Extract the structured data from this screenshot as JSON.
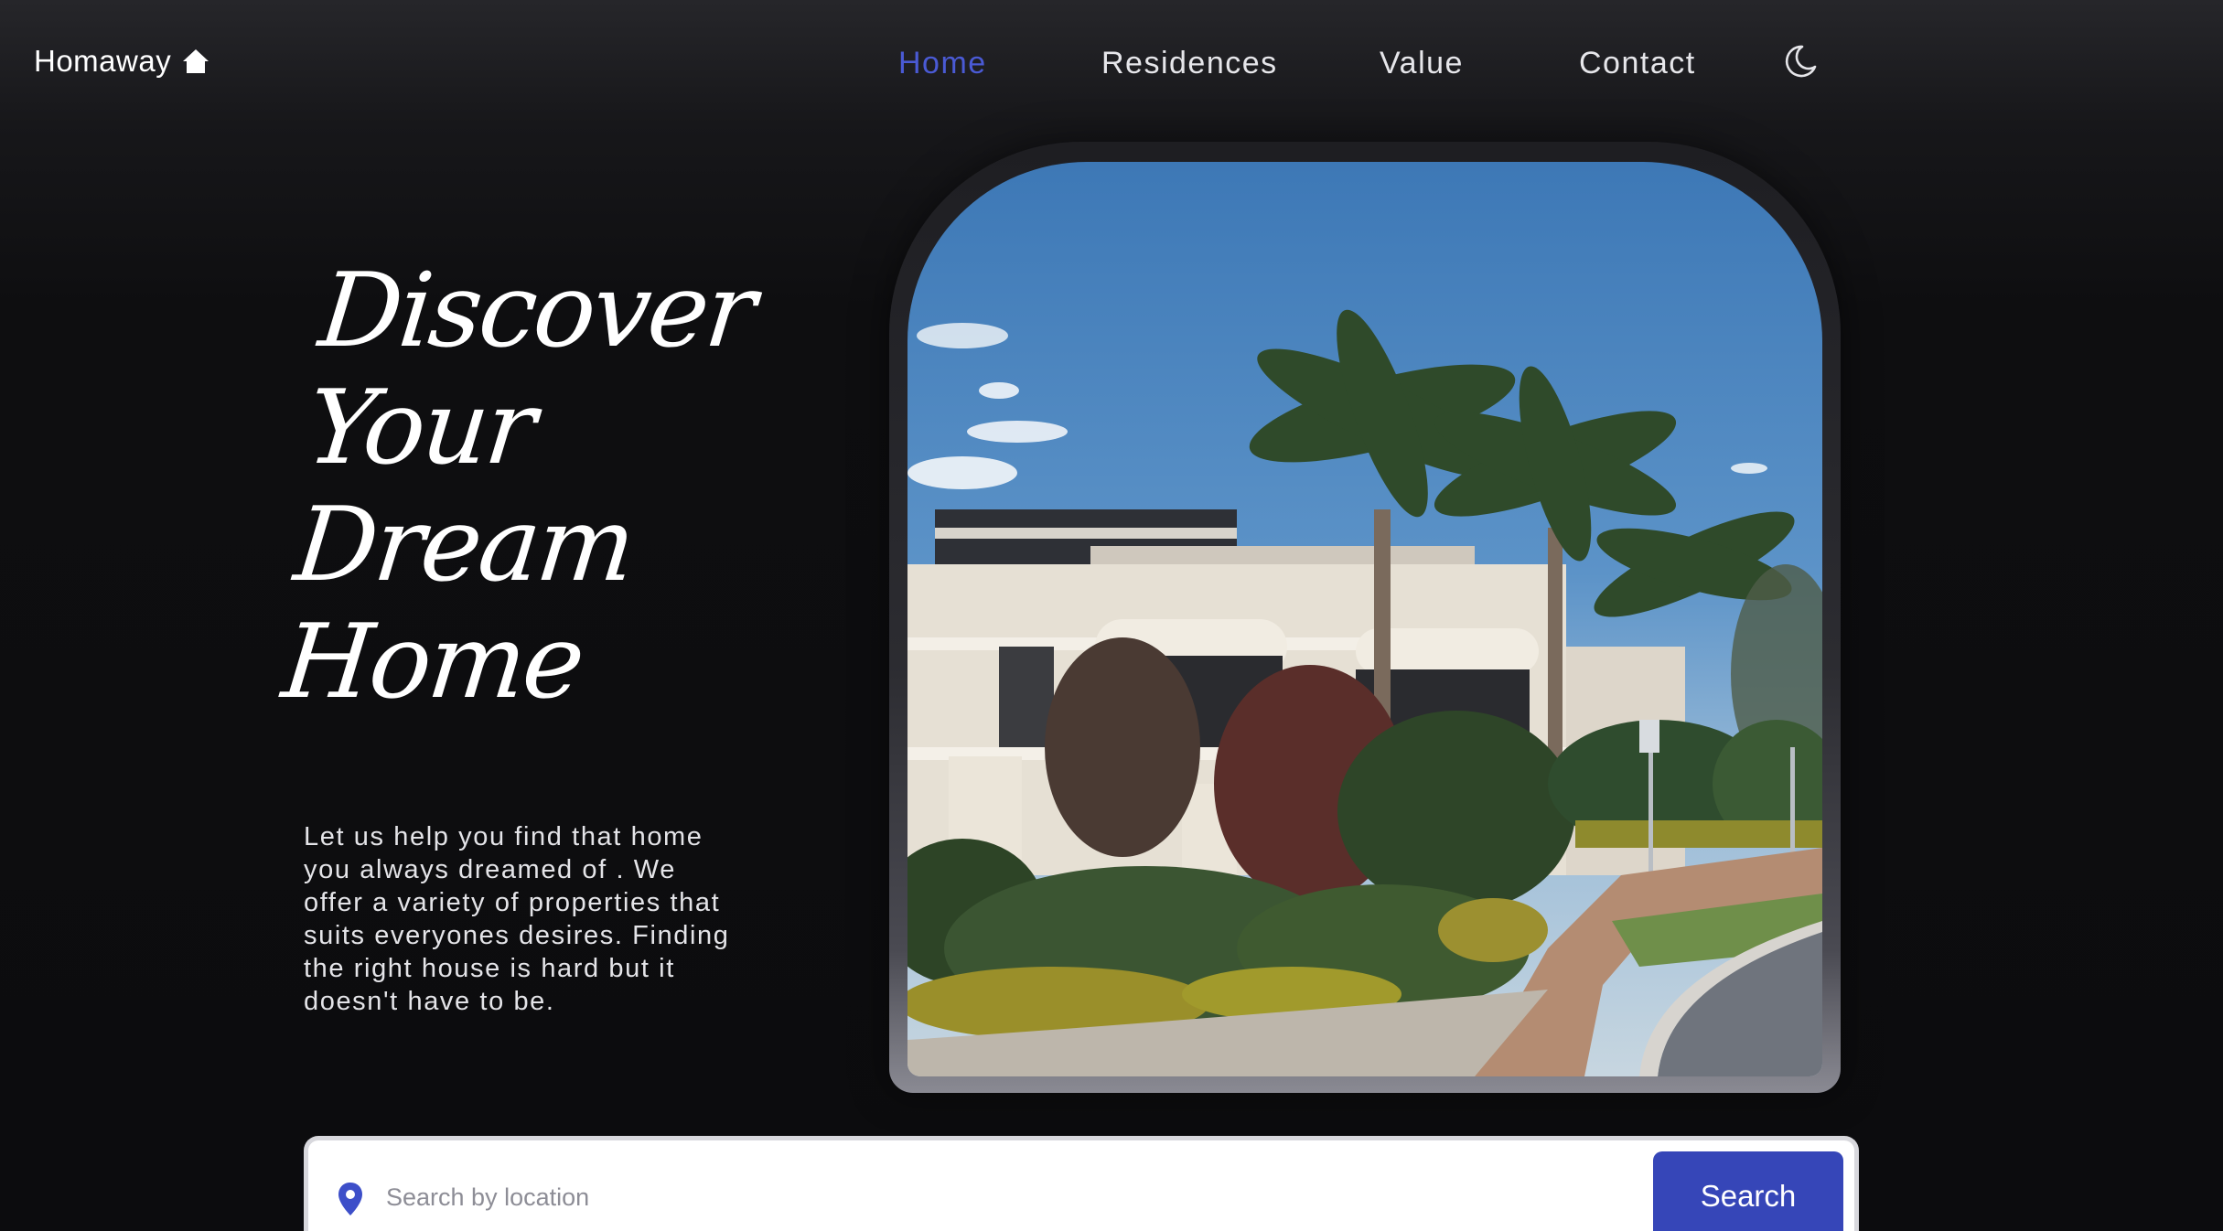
{
  "header": {
    "brand": "Homaway",
    "brand_icon": "home-icon",
    "nav": [
      {
        "label": "Home",
        "active": true
      },
      {
        "label": "Residences",
        "active": false
      },
      {
        "label": "Value",
        "active": false
      },
      {
        "label": "Contact",
        "active": false
      }
    ],
    "theme_toggle_icon": "moon-icon",
    "accent_color": "#4a5ad4"
  },
  "hero": {
    "title_lines": [
      "Discover",
      "Your",
      "Dream",
      "Home"
    ],
    "description": "Let us help you find that home you always dreamed of . We offer a variety of properties that suits everyones desires. Finding the right house is hard but it doesn't have to be."
  },
  "search": {
    "icon": "location-pin-icon",
    "placeholder": "Search by location",
    "value": "",
    "button_label": "Search",
    "button_color": "#3646b8"
  }
}
